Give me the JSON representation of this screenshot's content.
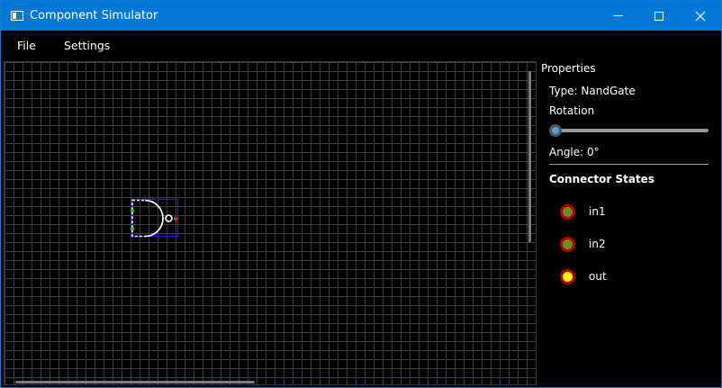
{
  "window": {
    "title": "Component Simulator"
  },
  "menu": {
    "file": "File",
    "settings": "Settings"
  },
  "properties": {
    "title": "Properties",
    "type": "Type: NandGate",
    "rotation_label": "Rotation",
    "rotation_value": 0,
    "angle": "Angle: 0°",
    "connector_states_title": "Connector States",
    "connectors": [
      {
        "name": "in1",
        "state": "low",
        "fill": "#6b8e23",
        "ring": "#b30000"
      },
      {
        "name": "in2",
        "state": "low",
        "fill": "#6b8e23",
        "ring": "#b30000"
      },
      {
        "name": "out",
        "state": "high",
        "fill": "#ffff00",
        "ring": "#b30000"
      }
    ]
  },
  "colors": {
    "titlebar": "#0078d4",
    "grid": "#3f3f3f",
    "input_pin": "#22cc22",
    "output_pin": "#ff2020",
    "selection_box": "#1a1aff",
    "slider_thumb": "#4aa3e8"
  },
  "icons": {
    "app": "app-window-icon",
    "minimize": "minimize-icon",
    "maximize": "maximize-icon",
    "close": "close-icon"
  }
}
